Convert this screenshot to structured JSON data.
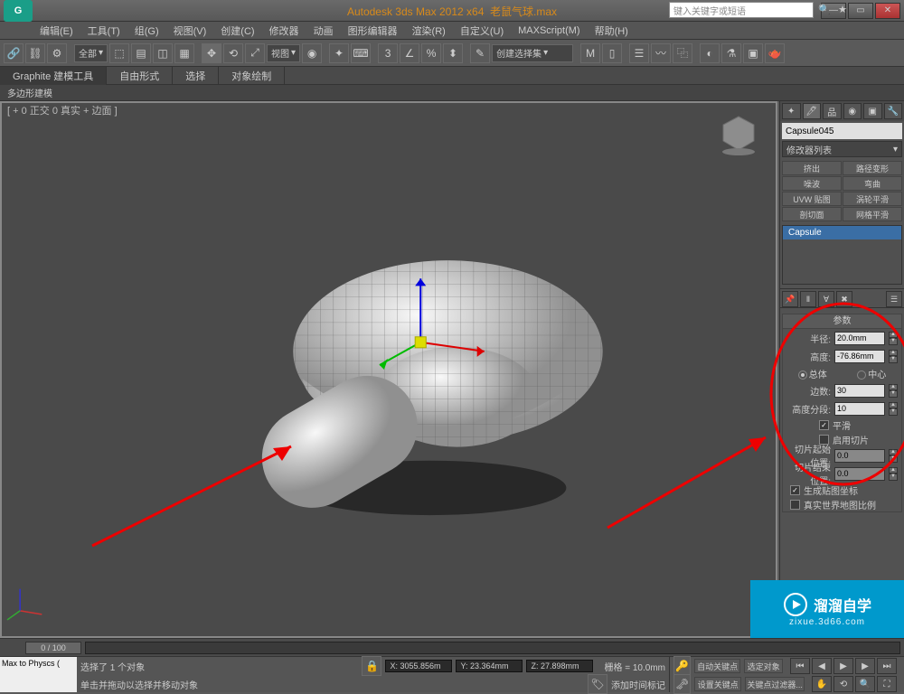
{
  "title": {
    "app": "Autodesk 3ds Max  2012 x64",
    "file": "老鼠气球.max",
    "search_ph": "键入关键字或短语"
  },
  "menubar": [
    "编辑(E)",
    "工具(T)",
    "组(G)",
    "视图(V)",
    "创建(C)",
    "修改器",
    "动画",
    "图形编辑器",
    "渲染(R)",
    "自定义(U)",
    "MAXScript(M)",
    "帮助(H)"
  ],
  "toolbar": {
    "scope": "全部",
    "vp_label": "视图",
    "cmd_set": "创建选择集"
  },
  "ribbon": {
    "tabs": [
      "Graphite 建模工具",
      "自由形式",
      "选择",
      "对象绘制"
    ],
    "sub": "多边形建模"
  },
  "viewport": {
    "label": "[ + 0 正交 0 真实 + 边面 ]"
  },
  "panel": {
    "obj_name": "Capsule045",
    "mod_list": "修改器列表",
    "mod_buttons": [
      "挤出",
      "路径变形",
      "噪波",
      "弯曲",
      "UVW 贴图",
      "涡轮平滑",
      "剖切面",
      "网格平滑"
    ],
    "stack_item": "Capsule",
    "rollout_title": "参数",
    "radius_lbl": "半径:",
    "radius": "20.0mm",
    "height_lbl": "高度:",
    "height": "-76.86mm",
    "overall": "总体",
    "center": "中心",
    "sides_lbl": "边数:",
    "sides": "30",
    "hsegs_lbl": "高度分段:",
    "hsegs": "10",
    "smooth": "平滑",
    "slice_on": "启用切片",
    "slice_from_lbl": "切片起始位置:",
    "slice_from": "0.0",
    "slice_to_lbl": "切片结束位置:",
    "slice_to": "0.0",
    "gen_map": "生成贴图坐标",
    "real_world": "真实世界地图比例"
  },
  "timeline": {
    "pos": "0 / 100"
  },
  "status": {
    "plugin": "Max to Physcs (",
    "sel": "选择了 1 个对象",
    "hint": "单击并拖动以选择并移动对象",
    "x": "X: 3055.856m",
    "y": "Y: 23.364mm",
    "z": "Z: 27.898mm",
    "grid": "栅格 = 10.0mm",
    "add_time": "添加时间标记",
    "autokey": "自动关键点",
    "selset": "选定对象",
    "setkey": "设置关键点",
    "keyfilter": "关键点过滤器..."
  },
  "watermark": {
    "brand": "溜溜自学",
    "url": "zixue.3d66.com"
  }
}
